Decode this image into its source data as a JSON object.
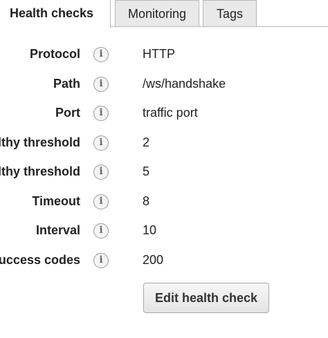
{
  "tabs": [
    {
      "label": "Health checks",
      "active": true
    },
    {
      "label": "Monitoring",
      "active": false
    },
    {
      "label": "Tags",
      "active": false
    }
  ],
  "info_icon_glyph": "i",
  "rows": [
    {
      "label": "Protocol",
      "value": "HTTP"
    },
    {
      "label": "Path",
      "value": "/ws/handshake"
    },
    {
      "label": "Port",
      "value": "traffic port"
    },
    {
      "label": "Healthy threshold",
      "value": "2"
    },
    {
      "label": "Unhealthy threshold",
      "value": "5"
    },
    {
      "label": "Timeout",
      "value": "8"
    },
    {
      "label": "Interval",
      "value": "10"
    },
    {
      "label": "Success codes",
      "value": "200"
    }
  ],
  "edit_button_label": "Edit health check",
  "colors": {
    "tab_inactive_bg": "#e9e9e9",
    "border": "#b8b8b8",
    "text": "#222222",
    "button_bg": "#efefef"
  }
}
